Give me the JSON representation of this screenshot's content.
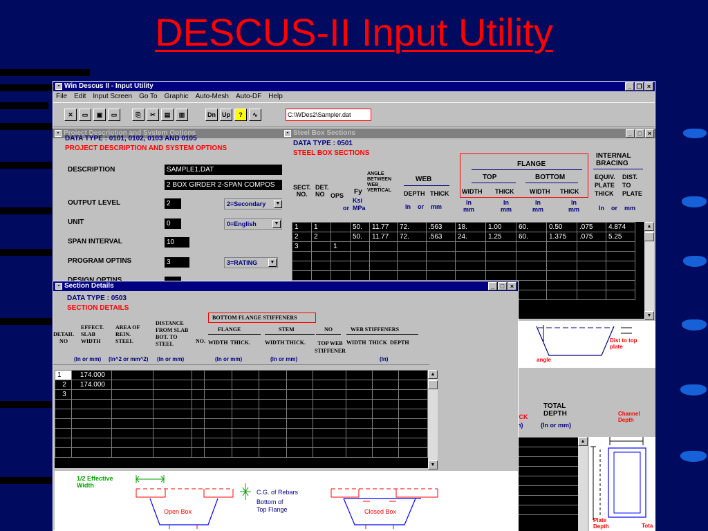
{
  "slide_title": "DESCUS-II Input Utility",
  "main_window": {
    "title": "Win Descus II -  Input Utility",
    "menu": [
      "File",
      "Edit",
      "Input Screen",
      "Go To",
      "Graphic",
      "Auto-Mesh",
      "Auto-DF",
      "Help"
    ],
    "toolbar_dn": "Dn",
    "toolbar_up": "Up",
    "toolbar_help": "?",
    "path": "C:\\WDes2\\Sampler.dat"
  },
  "project_window": {
    "title": "Project Description and System Options",
    "data_type": "DATA TYPE  : 0101, 0102, 0103 AND 0105",
    "heading": "PROJECT DESCRIPTION AND SYSTEM OPTIONS",
    "description_label": "DESCRIPTION",
    "description_value": "SAMPLE1.DAT",
    "description_value2": "2 BOX GIRDER 2-SPAN COMPOS",
    "output_level_label": "OUTPUT LEVEL",
    "output_level_value": "2",
    "output_level_option": "2=Secondary",
    "unit_label": "UNIT",
    "unit_value": "0",
    "unit_option": "0=English",
    "span_interval_label": "SPAN INTERVAL",
    "span_interval_value": "10",
    "program_optins_label": "PROGRAM OPTINS",
    "program_optins_value": "3",
    "program_optins_option": "3=RATING",
    "design_optins_label": "DESIGN OPTINS"
  },
  "steel_window": {
    "title": "Steel Box Sections",
    "data_type": "DATA TYPE : 0501",
    "heading": "STEEL BOX SECTIONS",
    "h_sect_no": "SECT.\nNO.",
    "h_det_no": "DET.\nNO",
    "h_ops": "OPS",
    "h_fy": "Fy",
    "h_ksi": "Ksi",
    "h_or": "or",
    "h_mpa": "MPa",
    "h_angle": "ANGLE\nBETWEEN\nWEB_\nVERTICAL",
    "h_web": "WEB",
    "h_depth": "DEPTH",
    "h_thick": "THICK",
    "h_web_units": "In    or    mm",
    "h_flange": "FLANGE",
    "h_top": "TOP",
    "h_bottom": "BOTTOM",
    "h_width": "WIDTH",
    "h_in_mm": "In\nmm",
    "h_internal_bracing": "INTERNAL\nBRACING",
    "h_equiv": "EQUIV.\nPLATE\nTHICK",
    "h_dist": "DIST.\nTO\nPLATE",
    "h_bracing_units": "In    or    mm",
    "rows": [
      [
        "1",
        "1",
        "",
        "50.",
        "11.77",
        "72.",
        ".563",
        "18.",
        "1.00",
        "60.",
        "0.50",
        ".075",
        "4.874"
      ],
      [
        "2",
        "2",
        "",
        "50.",
        "11.77",
        "72.",
        ".563",
        "24.",
        "1.25",
        "60.",
        "1.375",
        ".075",
        "5.25"
      ],
      [
        "3",
        "",
        "1",
        "",
        "",
        "",
        "",
        "",
        "",
        "",
        "",
        "",
        ""
      ]
    ],
    "diagram_angle": "angle",
    "diagram_dist": "Dist to top\nplate",
    "lower_ick": "ICK",
    "lower_n": "n)",
    "lower_total_depth": "TOTAL\nDEPTH",
    "lower_units": "(In  or  mm)",
    "lower_channel_depth": "Channel\nDepth",
    "lower_plate_depth": "Plate\nDepth",
    "lower_tota": "Tota"
  },
  "section_window": {
    "title": "Section Details",
    "data_type": "DATA TYPE : 0503",
    "heading": "SECTION DETAILS",
    "bfs_title": "BOTTOM FLANGE STIFFENERS",
    "h_detail_no": "DETAIL\nNO",
    "h_effect": "EFFECT.\nSLAB\nWIDTH",
    "h_area": "AREA OF\nREIN.\nSTEEL",
    "h_distance": "DISTANCE\nFROM SLAB\nBOT. TO\nSTEEL",
    "h_no": "NO.",
    "h_flange": "FLANGE",
    "h_flange_sub": "WIDTH  THICK.",
    "h_stem": "STEM",
    "h_stem_sub": "WIDTH THICK.",
    "h_no2": "NO",
    "h_top_web": "TOP WEB\nSTIFFENER",
    "h_web_stiff": "WEB STIFFENERS",
    "h_web_stiff_sub": "WIDTH  THICK  DEPTH",
    "u1": "(In or mm)",
    "u2": "(In^2 or mm^2)",
    "u3": "(In or mm)",
    "u4": "(In or mm)",
    "u5": "(In or mm)",
    "u6": "(In)",
    "rows": [
      [
        "1",
        "174.000"
      ],
      [
        "2",
        "174.000"
      ],
      [
        "3",
        ""
      ]
    ],
    "legend_eff_width": "1/2 Effective\nWidth",
    "legend_cg": "C.G. of Rebars",
    "legend_bottom": "Bottom of\nTop Flange",
    "legend_open_box": "Open Box",
    "legend_closed_box": "Closed Box"
  }
}
